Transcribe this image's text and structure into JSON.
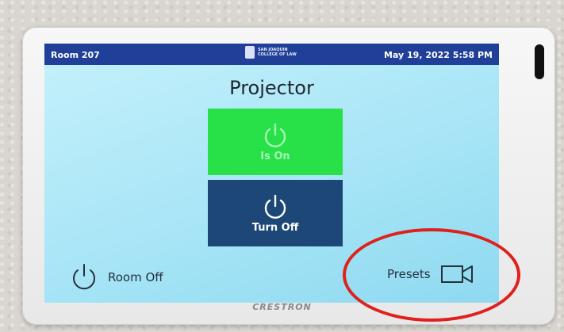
{
  "header": {
    "room": "Room 207",
    "logo_line1": "SAN JOAQUIN",
    "logo_line2": "COLLEGE OF LAW",
    "datetime": "May 19, 2022 5:58 PM"
  },
  "main": {
    "title": "Projector",
    "on_tile_label": "Is On",
    "off_tile_label": "Turn Off"
  },
  "footer": {
    "room_off_label": "Room Off",
    "presets_label": "Presets"
  },
  "device": {
    "brand": "CRESTRON"
  },
  "colors": {
    "header_bar": "#1f3f99",
    "screen_bg": "#a5e4f6",
    "on_tile": "#28e048",
    "off_tile": "#1c4776",
    "highlight_circle": "#e0201a"
  },
  "icons": [
    "power-icon",
    "video-camera-icon",
    "school-seal-icon"
  ]
}
